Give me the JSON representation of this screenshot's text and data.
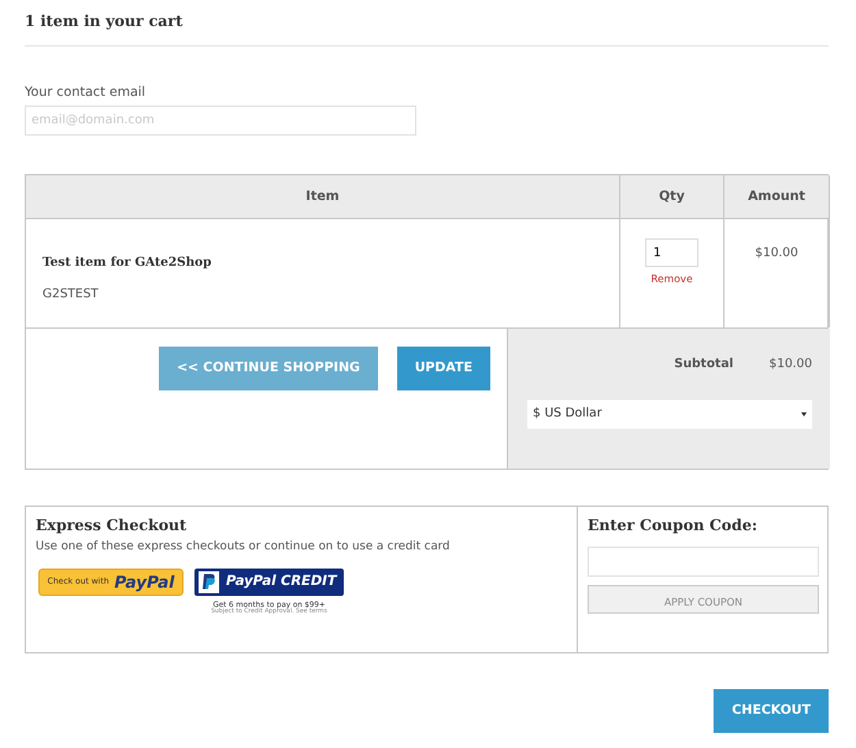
{
  "heading": "1 item in your cart",
  "email": {
    "label": "Your contact email",
    "placeholder": "email@domain.com"
  },
  "cart": {
    "columns": [
      "Item",
      "Qty",
      "Amount"
    ],
    "items": [
      {
        "name": "Test item for GAte2Shop",
        "sku": "G2STEST",
        "qty": "1",
        "remove": "Remove",
        "amount": "$10.00"
      }
    ]
  },
  "actions": {
    "continue": "<< CONTINUE SHOPPING",
    "update": "UPDATE"
  },
  "summary": {
    "subtotal_label": "Subtotal",
    "subtotal": "$10.00",
    "currency": "$ US Dollar"
  },
  "express": {
    "title": "Express Checkout",
    "text": "Use one of these express checkouts or continue on to use a credit card",
    "paypal": {
      "prefix": "Check out with",
      "brand": "PayPal"
    },
    "credit": {
      "label": "PayPal CREDIT",
      "offer": "Get 6 months to pay on $99+",
      "terms": "Subject to Credit Approval. See terms"
    }
  },
  "coupon": {
    "title": "Enter Coupon Code:",
    "button": "APPLY COUPON",
    "button_disabled": true
  },
  "checkout": "CHECKOUT"
}
